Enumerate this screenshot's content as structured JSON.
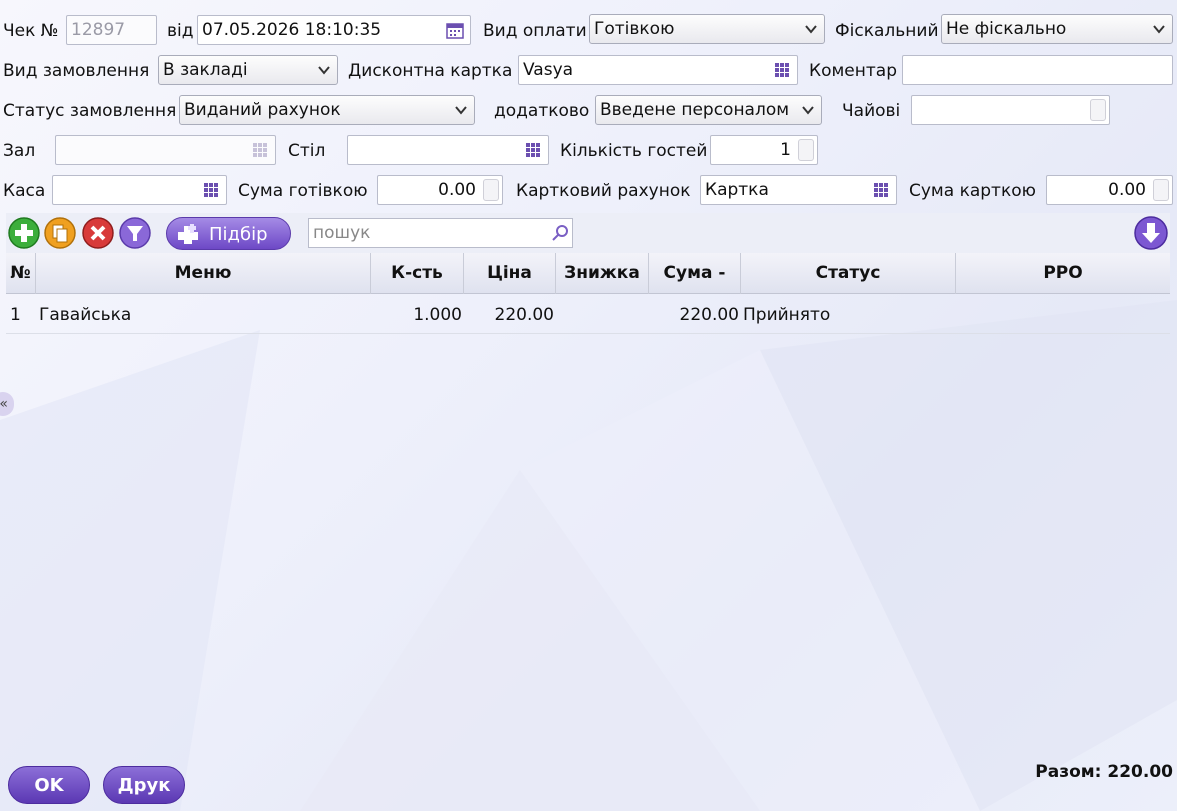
{
  "header": {
    "check_no_label": "Чек №",
    "check_no_value": "12897",
    "date_label": "від",
    "date_value": "07.05.2026 18:10:35",
    "payment_type_label": "Вид оплати",
    "payment_type_value": "Готівкою",
    "fiscal_label": "Фіскальний",
    "fiscal_value": "Не фіскально",
    "order_type_label": "Вид замовлення",
    "order_type_value": "В закладі",
    "discount_card_label": "Дисконтна картка",
    "discount_card_value": "Vasya",
    "comment_label": "Коментар",
    "comment_value": "",
    "order_status_label": "Статус замовлення",
    "order_status_value": "Виданий рахунок",
    "extra_label": "додатково",
    "extra_value": "Введене персоналом",
    "tips_label": "Чайові",
    "tips_value": "",
    "hall_label": "Зал",
    "hall_value": "",
    "table_label": "Стіл",
    "table_value": "",
    "guests_label": "Кількість гостей",
    "guests_value": "1",
    "cashbox_label": "Каса",
    "cashbox_value": "",
    "cash_sum_label": "Сума готівкою",
    "cash_sum_value": "0.00",
    "card_account_label": "Картковий рахунок",
    "card_account_value": "Картка",
    "card_sum_label": "Сума карткою",
    "card_sum_value": "0.00"
  },
  "toolbar": {
    "pick_label": "Підбір",
    "search_placeholder": "пошук"
  },
  "table": {
    "columns": [
      "№",
      "Меню",
      "К-сть",
      "Ціна",
      "Знижка",
      "Сума -",
      "Статус",
      "PPO"
    ],
    "rows": [
      {
        "num": "1",
        "menu": "Гавайська",
        "qty": "1.000",
        "price": "220.00",
        "discount": "",
        "sum": "220.00",
        "status": "Прийнято",
        "ppo": ""
      }
    ]
  },
  "footer": {
    "ok_label": "OK",
    "print_label": "Друк",
    "total_text": "Разом: 220.00"
  },
  "colors": {
    "accent": "#6d48c6",
    "add": "#3cae3c",
    "copy": "#f0a020",
    "delete": "#d83a3a"
  }
}
